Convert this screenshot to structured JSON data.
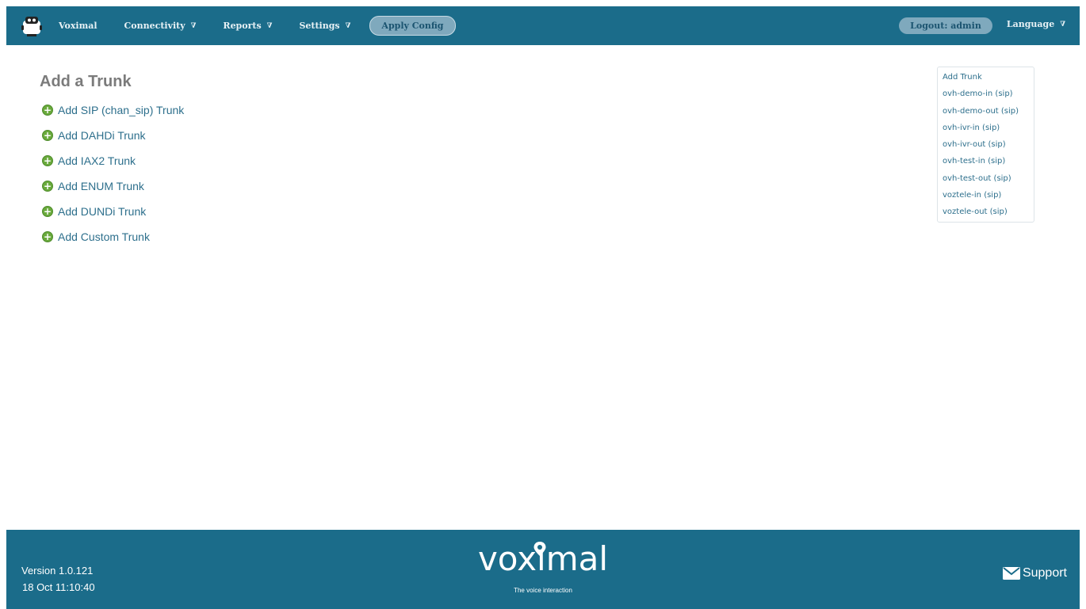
{
  "header": {
    "nav": [
      {
        "label": "Voximal",
        "has_menu": false
      },
      {
        "label": "Connectivity",
        "has_menu": true
      },
      {
        "label": "Reports",
        "has_menu": true
      },
      {
        "label": "Settings",
        "has_menu": true
      }
    ],
    "apply_label": "Apply Config",
    "logout_label": "Logout: admin",
    "language_label": "Language",
    "dropdown_arrow": "∇",
    "accent": "#1b6c8a"
  },
  "main": {
    "title": "Add a Trunk",
    "items": [
      "Add SIP (chan_sip) Trunk",
      "Add DAHDi Trunk",
      "Add IAX2 Trunk",
      "Add ENUM Trunk",
      "Add DUNDi Trunk",
      "Add Custom Trunk"
    ],
    "item_icon": "plus-circle-icon"
  },
  "sidebar": {
    "items": [
      "Add Trunk",
      "ovh-demo-in (sip)",
      "ovh-demo-out (sip)",
      "ovh-ivr-in (sip)",
      "ovh-ivr-out (sip)",
      "ovh-test-in (sip)",
      "ovh-test-out (sip)",
      "voztele-in (sip)",
      "voztele-out (sip)"
    ]
  },
  "footer": {
    "version": "Version 1.0.121",
    "datetime": "18 Oct 11:10:40",
    "brand": "voximal",
    "tagline": "The voice interaction",
    "support_label": "Support",
    "support_icon": "envelope-icon"
  }
}
